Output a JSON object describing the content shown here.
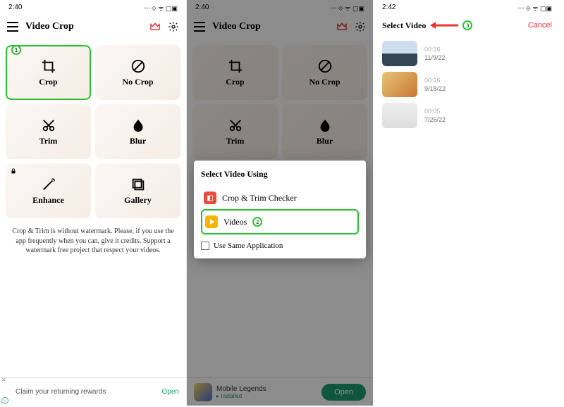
{
  "screen1": {
    "time": "2:40",
    "status_glyphs": "᠁ ⟐ ᯤ ▢▣",
    "app_title": "Video Crop",
    "tiles": {
      "crop": "Crop",
      "nocrop": "No Crop",
      "trim": "Trim",
      "blur": "Blur",
      "enhance": "Enhance",
      "gallery": "Gallery"
    },
    "footnote": "Crop & Trim is without watermark. Please, if you use the app frequently when you can, give it credits. Support a watermark free project that respect your videos.",
    "ad_text": "Claim your returning rewards",
    "ad_open": "Open",
    "badge": "1"
  },
  "screen2": {
    "time": "2:40",
    "status_glyphs": "᠁ ⟐ ᯤ ▢▣",
    "app_title": "Video Crop",
    "dialog_title": "Select Video Using",
    "item1": "Crop & Trim Checker",
    "item2": "Videos",
    "use_same": "Use Same Application",
    "badge": "2",
    "ad_title": "Mobile Legends",
    "ad_sub": "▸ Installed",
    "ad_open": "Open"
  },
  "screen3": {
    "time": "2:42",
    "status_glyphs": "᠁ ⟐ ᯤ ▢▣",
    "title": "Select Video",
    "cancel": "Cancel",
    "badge": "3",
    "videos": [
      {
        "dur": "00:16",
        "date": "11/9/22"
      },
      {
        "dur": "00:16",
        "date": "9/18/22"
      },
      {
        "dur": "00:05",
        "date": "7/26/22"
      }
    ]
  }
}
